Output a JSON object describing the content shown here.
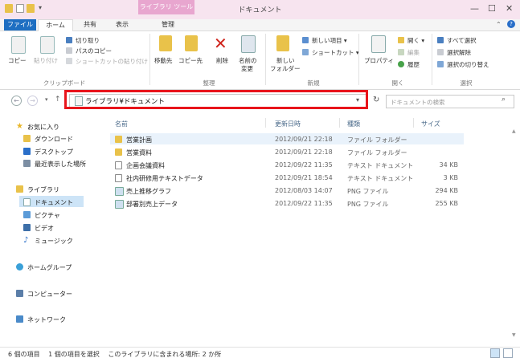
{
  "window": {
    "title": "ドキュメント",
    "context_tab": "ライブラリ ツール",
    "controls": {
      "minimize": "—",
      "maximize": "☐",
      "close": "✕"
    }
  },
  "tabs": {
    "file": "ファイル",
    "home": "ホーム",
    "share": "共有",
    "view": "表示",
    "manage": "管理"
  },
  "ribbon": {
    "clipboard": {
      "label": "クリップボード",
      "copy": "コピー",
      "paste": "貼り付け",
      "cut": "切り取り",
      "copy_path": "パスのコピー",
      "paste_shortcut": "ショートカットの貼り付け"
    },
    "organize": {
      "label": "整理",
      "move_to": "移動先",
      "copy_to": "コピー先",
      "delete": "削除",
      "rename_line1": "名前の",
      "rename_line2": "変更"
    },
    "new": {
      "label": "新規",
      "new_folder_line1": "新しい",
      "new_folder_line2": "フォルダー",
      "new_item": "新しい項目 ▾",
      "shortcut": "ショートカット ▾"
    },
    "open": {
      "label": "開く",
      "properties": "プロパティ",
      "open": "開く ▾",
      "edit": "編集",
      "history": "履歴"
    },
    "select": {
      "label": "選択",
      "select_all": "すべて選択",
      "select_none": "選択解除",
      "invert": "選択の切り替え"
    }
  },
  "address": {
    "path": "ライブラリ¥ドキュメント",
    "search_placeholder": "ドキュメントの検索"
  },
  "nav": {
    "favorites": "お気に入り",
    "downloads": "ダウンロード",
    "desktop": "デスクトップ",
    "recent": "最近表示した場所",
    "libraries": "ライブラリ",
    "documents": "ドキュメント",
    "pictures": "ピクチャ",
    "videos": "ビデオ",
    "music": "ミュージック",
    "homegroup": "ホームグループ",
    "computer": "コンピューター",
    "network": "ネットワーク"
  },
  "columns": {
    "name": "名前",
    "date": "更新日時",
    "type": "種類",
    "size": "サイズ"
  },
  "files": [
    {
      "name": "営業計画",
      "date": "2012/09/21 22:18",
      "type": "ファイル フォルダー",
      "size": "",
      "icon": "folder-icon"
    },
    {
      "name": "営業資料",
      "date": "2012/09/21 22:18",
      "type": "ファイル フォルダー",
      "size": "",
      "icon": "folder-icon"
    },
    {
      "name": "企画会議資料",
      "date": "2012/09/22 11:35",
      "type": "テキスト ドキュメント",
      "size": "34 KB",
      "icon": "text-file-icon"
    },
    {
      "name": "社内研修用テキストデータ",
      "date": "2012/09/21 18:54",
      "type": "テキスト ドキュメント",
      "size": "3 KB",
      "icon": "text-file-icon"
    },
    {
      "name": "売上推移グラフ",
      "date": "2012/08/03 14:07",
      "type": "PNG ファイル",
      "size": "294 KB",
      "icon": "image-file-icon"
    },
    {
      "name": "部署別売上データ",
      "date": "2012/09/22 11:35",
      "type": "PNG ファイル",
      "size": "255 KB",
      "icon": "image-file-icon"
    }
  ],
  "status": {
    "text": "6 個の項目　 1 個の項目を選択　 このライブラリに含まれる場所: 2 か所"
  },
  "colors": {
    "accent": "#1e6fc2",
    "highlight": "#e8141b",
    "context": "#e8a6cf"
  }
}
